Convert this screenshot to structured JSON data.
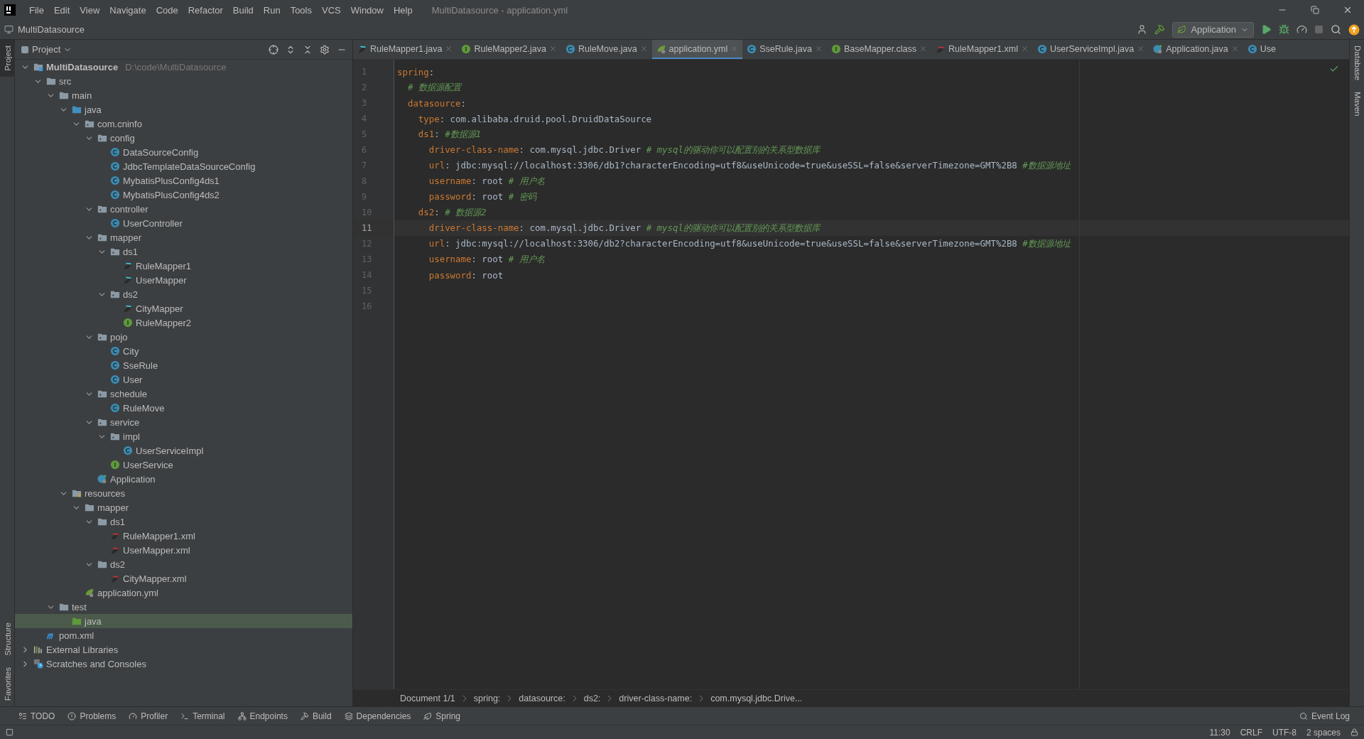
{
  "window": {
    "title": "MultiDatasource - application.yml"
  },
  "menu": [
    "File",
    "Edit",
    "View",
    "Navigate",
    "Code",
    "Refactor",
    "Build",
    "Run",
    "Tools",
    "VCS",
    "Window",
    "Help"
  ],
  "nav_bar": {
    "project": "MultiDatasource",
    "run_config": "Application"
  },
  "left_strip": [
    {
      "label": "Project",
      "selected": true
    },
    {
      "label": "Structure",
      "selected": false
    },
    {
      "label": "Favorites",
      "selected": false
    }
  ],
  "right_strip": [
    {
      "label": "Database"
    },
    {
      "label": "Maven"
    }
  ],
  "project_panel": {
    "title": "Project",
    "tree": [
      {
        "label": "MultiDatasource",
        "path": "D:\\code\\MultiDatasource",
        "kind": "module",
        "expanded": true,
        "selected": false,
        "children": [
          {
            "label": "src",
            "kind": "folder",
            "expanded": true,
            "selected": false,
            "children": [
              {
                "label": "main",
                "kind": "folder",
                "expanded": true,
                "selected": false,
                "children": [
                  {
                    "label": "java",
                    "kind": "source",
                    "expanded": true,
                    "selected": false,
                    "children": [
                      {
                        "label": "com.cninfo",
                        "kind": "package",
                        "expanded": true,
                        "selected": false,
                        "children": [
                          {
                            "label": "config",
                            "kind": "package",
                            "expanded": true,
                            "selected": false,
                            "children": [
                              {
                                "label": "DataSourceConfig",
                                "kind": "class",
                                "selected": false
                              },
                              {
                                "label": "JdbcTemplateDataSourceConfig",
                                "kind": "class",
                                "selected": false
                              },
                              {
                                "label": "MybatisPlusConfig4ds1",
                                "kind": "class",
                                "selected": false
                              },
                              {
                                "label": "MybatisPlusConfig4ds2",
                                "kind": "class",
                                "selected": false
                              }
                            ]
                          },
                          {
                            "label": "controller",
                            "kind": "package",
                            "expanded": true,
                            "selected": false,
                            "children": [
                              {
                                "label": "UserController",
                                "kind": "class",
                                "selected": false
                              }
                            ]
                          },
                          {
                            "label": "mapper",
                            "kind": "package",
                            "expanded": true,
                            "selected": false,
                            "children": [
                              {
                                "label": "ds1",
                                "kind": "package",
                                "expanded": true,
                                "selected": false,
                                "children": [
                                  {
                                    "label": "RuleMapper1",
                                    "kind": "mapper",
                                    "selected": false
                                  },
                                  {
                                    "label": "UserMapper",
                                    "kind": "mapper",
                                    "selected": false
                                  }
                                ]
                              },
                              {
                                "label": "ds2",
                                "kind": "package",
                                "expanded": true,
                                "selected": false,
                                "children": [
                                  {
                                    "label": "CityMapper",
                                    "kind": "mapper",
                                    "selected": false
                                  },
                                  {
                                    "label": "RuleMapper2",
                                    "kind": "interface",
                                    "selected": false
                                  }
                                ]
                              }
                            ]
                          },
                          {
                            "label": "pojo",
                            "kind": "package",
                            "expanded": true,
                            "selected": false,
                            "children": [
                              {
                                "label": "City",
                                "kind": "class",
                                "selected": false
                              },
                              {
                                "label": "SseRule",
                                "kind": "class",
                                "selected": false
                              },
                              {
                                "label": "User",
                                "kind": "class",
                                "selected": false
                              }
                            ]
                          },
                          {
                            "label": "schedule",
                            "kind": "package",
                            "expanded": true,
                            "selected": false,
                            "children": [
                              {
                                "label": "RuleMove",
                                "kind": "class",
                                "selected": false
                              }
                            ]
                          },
                          {
                            "label": "service",
                            "kind": "package",
                            "expanded": true,
                            "selected": false,
                            "children": [
                              {
                                "label": "impl",
                                "kind": "package",
                                "expanded": true,
                                "selected": false,
                                "children": [
                                  {
                                    "label": "UserServiceImpl",
                                    "kind": "class",
                                    "selected": false
                                  }
                                ]
                              },
                              {
                                "label": "UserService",
                                "kind": "interface",
                                "selected": false
                              }
                            ]
                          },
                          {
                            "label": "Application",
                            "kind": "app",
                            "selected": false
                          }
                        ]
                      }
                    ]
                  },
                  {
                    "label": "resources",
                    "kind": "resources",
                    "expanded": true,
                    "selected": false,
                    "children": [
                      {
                        "label": "mapper",
                        "kind": "folder",
                        "expanded": true,
                        "selected": false,
                        "children": [
                          {
                            "label": "ds1",
                            "kind": "folder",
                            "expanded": true,
                            "selected": false,
                            "children": [
                              {
                                "label": "RuleMapper1.xml",
                                "kind": "xml",
                                "selected": false
                              },
                              {
                                "label": "UserMapper.xml",
                                "kind": "xml",
                                "selected": false
                              }
                            ]
                          },
                          {
                            "label": "ds2",
                            "kind": "folder",
                            "expanded": true,
                            "selected": false,
                            "children": [
                              {
                                "label": "CityMapper.xml",
                                "kind": "xml",
                                "selected": false
                              }
                            ]
                          }
                        ]
                      },
                      {
                        "label": "application.yml",
                        "kind": "yml",
                        "selected": false
                      }
                    ]
                  }
                ]
              },
              {
                "label": "test",
                "kind": "folder",
                "expanded": true,
                "selected": false,
                "children": [
                  {
                    "label": "java",
                    "kind": "test",
                    "selected": true
                  }
                ]
              }
            ]
          },
          {
            "label": "pom.xml",
            "kind": "maven",
            "selected": false
          }
        ]
      },
      {
        "label": "External Libraries",
        "kind": "libraries",
        "expanded": false,
        "selected": false
      },
      {
        "label": "Scratches and Consoles",
        "kind": "scratches",
        "expanded": false,
        "selected": false
      }
    ]
  },
  "tabs": [
    {
      "label": "RuleMapper1.java",
      "kind": "mapper",
      "selected": false
    },
    {
      "label": "RuleMapper2.java",
      "kind": "interface",
      "selected": false
    },
    {
      "label": "RuleMove.java",
      "kind": "class",
      "selected": false
    },
    {
      "label": "application.yml",
      "kind": "yml",
      "selected": true
    },
    {
      "label": "SseRule.java",
      "kind": "class",
      "selected": false
    },
    {
      "label": "BaseMapper.class",
      "kind": "interface",
      "selected": false
    },
    {
      "label": "RuleMapper1.xml",
      "kind": "xml",
      "selected": false
    },
    {
      "label": "UserServiceImpl.java",
      "kind": "class",
      "selected": false
    },
    {
      "label": "Application.java",
      "kind": "app",
      "selected": false
    },
    {
      "label": "Use",
      "kind": "class",
      "selected": false,
      "cut": true
    }
  ],
  "editor": {
    "lines": [
      {
        "number": "1",
        "current": false,
        "tokens": [
          {
            "kind": "key",
            "text": "spring"
          },
          {
            "kind": "plain",
            "text": ":"
          }
        ]
      },
      {
        "number": "2",
        "current": false,
        "tokens": [
          {
            "kind": "comment",
            "text": "  # 数据源配置"
          }
        ]
      },
      {
        "number": "3",
        "current": false,
        "tokens": [
          {
            "kind": "key",
            "text": "  datasource"
          },
          {
            "kind": "plain",
            "text": ":"
          }
        ]
      },
      {
        "number": "4",
        "current": false,
        "tokens": [
          {
            "kind": "key",
            "text": "    type"
          },
          {
            "kind": "plain",
            "text": ": com.alibaba.druid.pool.DruidDataSource"
          }
        ]
      },
      {
        "number": "5",
        "current": false,
        "tokens": [
          {
            "kind": "key",
            "text": "    ds1"
          },
          {
            "kind": "plain",
            "text": ": "
          },
          {
            "kind": "comment",
            "text": "#数据源1"
          }
        ]
      },
      {
        "number": "6",
        "current": false,
        "tokens": [
          {
            "kind": "key",
            "text": "      driver-class-name"
          },
          {
            "kind": "plain",
            "text": ": com.mysql.jdbc.Driver "
          },
          {
            "kind": "comment",
            "text": "# mysql的驱动你可以配置别的关系型数据库"
          }
        ]
      },
      {
        "number": "7",
        "current": false,
        "tokens": [
          {
            "kind": "key",
            "text": "      url"
          },
          {
            "kind": "plain",
            "text": ": jdbc:mysql://localhost:3306/db1?characterEncoding=utf8&useUnicode=true&useSSL=false&serverTimezone=GMT%2B8 "
          },
          {
            "kind": "comment",
            "text": "#数据源地址"
          }
        ]
      },
      {
        "number": "8",
        "current": false,
        "tokens": [
          {
            "kind": "key",
            "text": "      username"
          },
          {
            "kind": "plain",
            "text": ": root "
          },
          {
            "kind": "comment",
            "text": "# 用户名"
          }
        ]
      },
      {
        "number": "9",
        "current": false,
        "tokens": [
          {
            "kind": "key",
            "text": "      password"
          },
          {
            "kind": "plain",
            "text": ": root "
          },
          {
            "kind": "comment",
            "text": "# 密码"
          }
        ]
      },
      {
        "number": "10",
        "current": false,
        "tokens": [
          {
            "kind": "key",
            "text": "    ds2"
          },
          {
            "kind": "plain",
            "text": ": "
          },
          {
            "kind": "comment",
            "text": "# 数据源2"
          }
        ]
      },
      {
        "number": "11",
        "current": true,
        "tokens": [
          {
            "kind": "key",
            "text": "      driver-class-name"
          },
          {
            "kind": "plain",
            "text": ": com.mysql.jdbc.Driver "
          },
          {
            "kind": "comment",
            "text": "# mysql的驱动你可以配置别的关系型数据库"
          }
        ]
      },
      {
        "number": "12",
        "current": false,
        "tokens": [
          {
            "kind": "key",
            "text": "      url"
          },
          {
            "kind": "plain",
            "text": ": jdbc:mysql://localhost:3306/db2?characterEncoding=utf8&useUnicode=true&useSSL=false&serverTimezone=GMT%2B8 "
          },
          {
            "kind": "comment",
            "text": "#数据源地址"
          }
        ]
      },
      {
        "number": "13",
        "current": false,
        "tokens": [
          {
            "kind": "key",
            "text": "      username"
          },
          {
            "kind": "plain",
            "text": ": root "
          },
          {
            "kind": "comment",
            "text": "# 用户名"
          }
        ]
      },
      {
        "number": "14",
        "current": false,
        "tokens": [
          {
            "kind": "key",
            "text": "      password"
          },
          {
            "kind": "plain",
            "text": ": root"
          }
        ]
      },
      {
        "number": "15",
        "current": false
      },
      {
        "number": "16",
        "current": false
      }
    ],
    "breadcrumbs": [
      "Document 1/1",
      "spring:",
      "datasource:",
      "ds2:",
      "driver-class-name:",
      "com.mysql.jdbc.Drive..."
    ]
  },
  "tool_windows": [
    "TODO",
    "Problems",
    "Profiler",
    "Terminal",
    "Endpoints",
    "Build",
    "Dependencies",
    "Spring"
  ],
  "event_log": "Event Log",
  "status_bar": {
    "position": "11:30",
    "line_separator": "CRLF",
    "encoding": "UTF-8",
    "indent": "2 spaces"
  }
}
